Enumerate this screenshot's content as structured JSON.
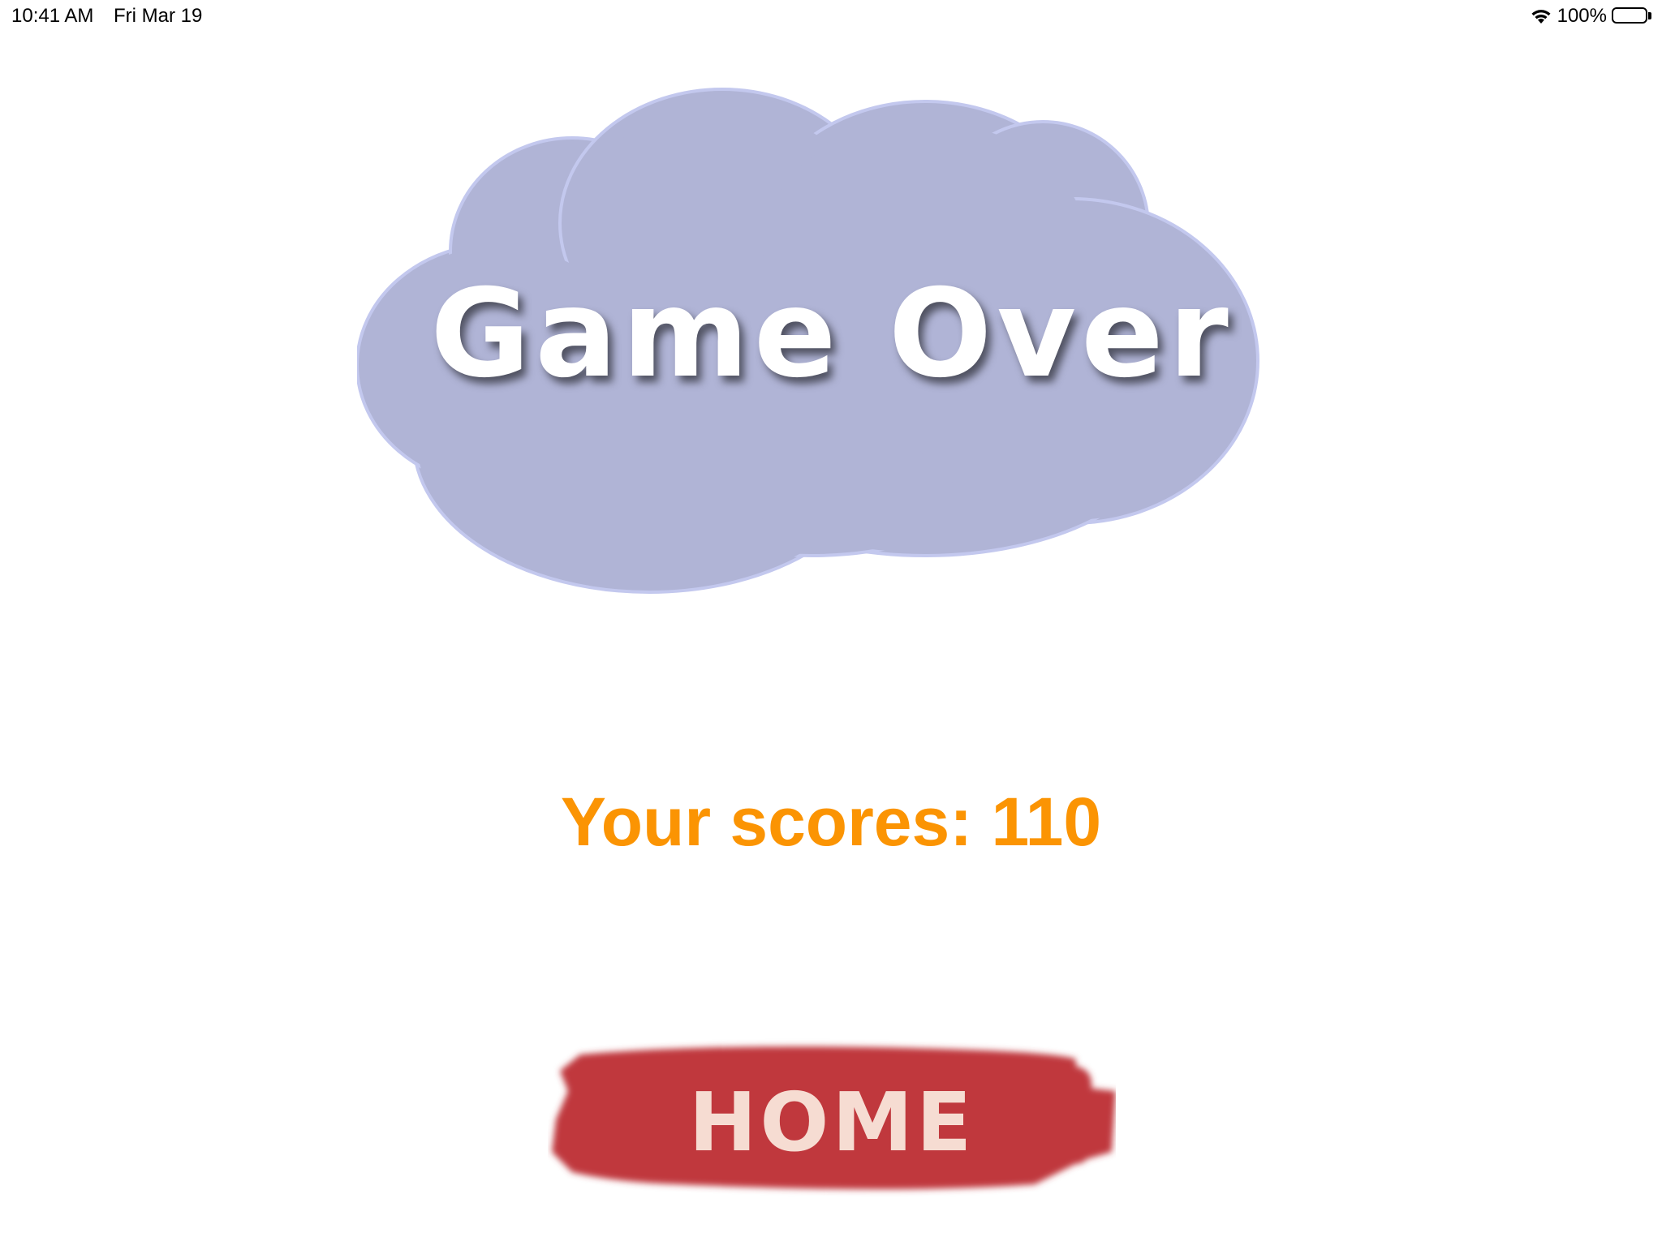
{
  "status_bar": {
    "time": "10:41 AM",
    "date": "Fri Mar 19",
    "battery": "100%",
    "battery_level": 1.0
  },
  "title": {
    "text": "Game Over",
    "cloud_color": "#b0b4d6"
  },
  "score": {
    "text": "Your scores: 110",
    "color": "#fb9403"
  },
  "home_button": {
    "label": "HOME",
    "color": "#c0393e",
    "label_color": "#f6dcd2"
  }
}
